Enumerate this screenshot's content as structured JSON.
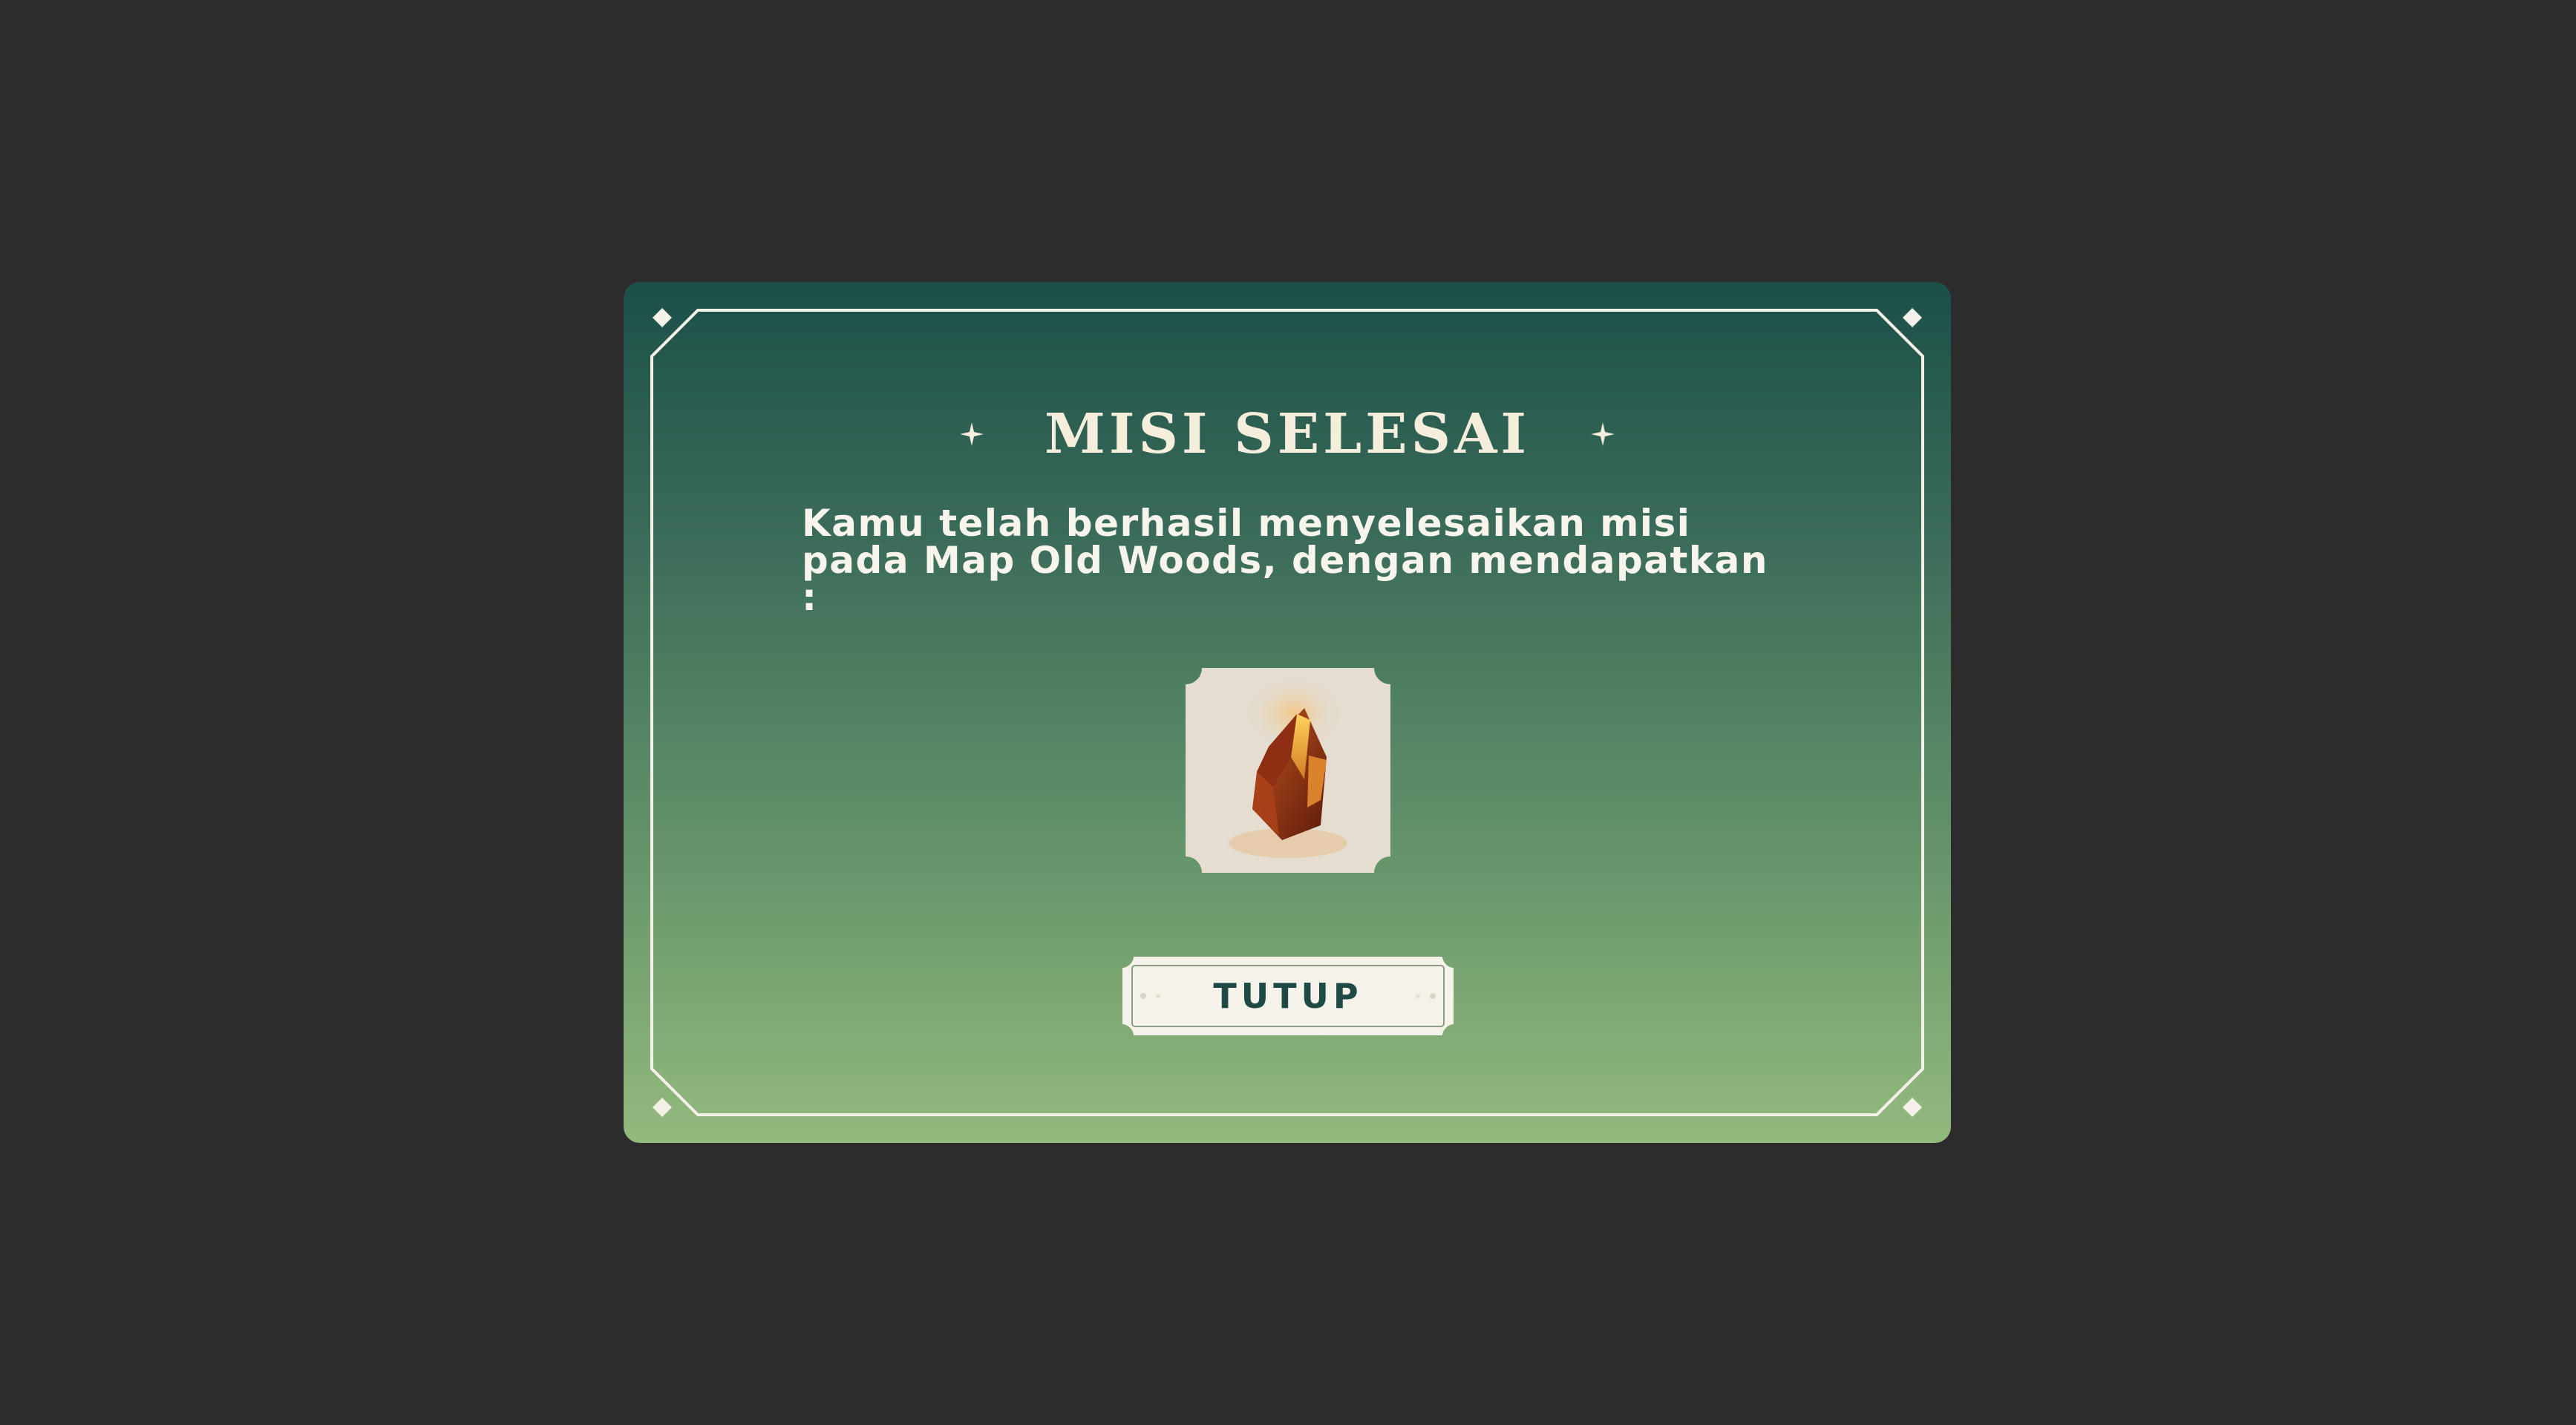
{
  "colors": {
    "backdrop": "#2c2c2c",
    "panel_top": "#1c4f48",
    "panel_bottom": "#94ba7d",
    "frame_line": "#f4f1e8",
    "title_text": "#f6eedc",
    "button_bg": "#f5f2ea",
    "button_text": "#1e4a45",
    "reward_card_bg": "#e4ddd0"
  },
  "dialog": {
    "title": "MISI SELESAI",
    "message": "Kamu telah berhasil menyelesaikan misi pada Map Old Woods, dengan mendapatkan :",
    "reward": {
      "icon": "amber-crystal-icon"
    },
    "close_button_label": "TUTUP"
  }
}
